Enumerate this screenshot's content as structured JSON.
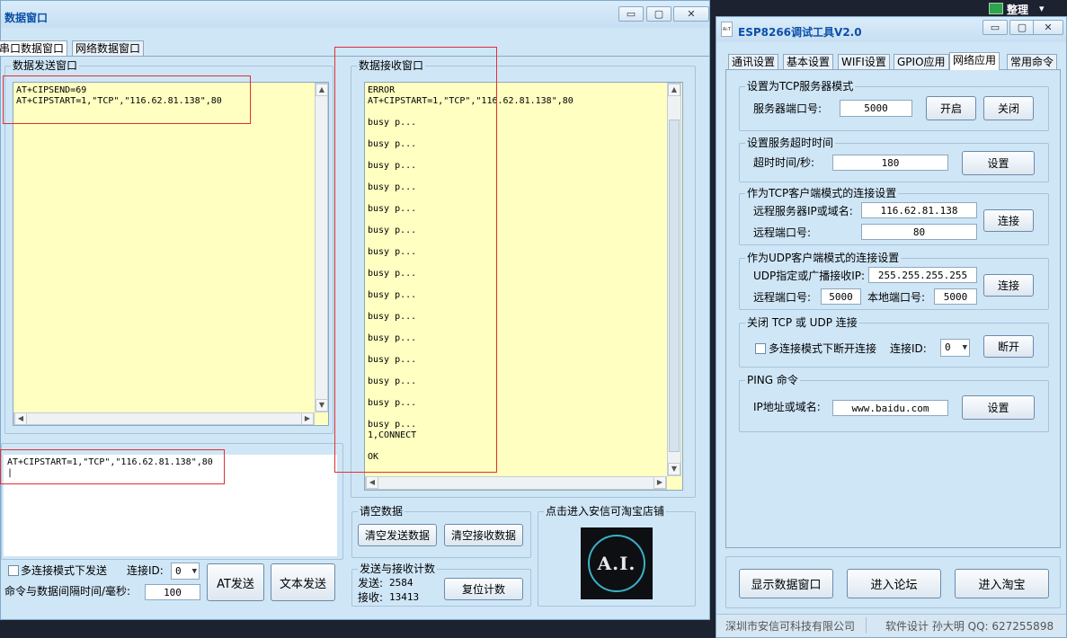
{
  "taskbar": {
    "label": "整理",
    "arrow": "▾"
  },
  "data_window": {
    "title": "数据窗口",
    "caption": {
      "minimize": "▭",
      "maximize": "▢",
      "close": "✕"
    },
    "tabs": [
      "串口数据窗口",
      "网络数据窗口"
    ],
    "send_group": {
      "title": "数据发送窗口",
      "text": "AT+CIPSEND=69\nAT+CIPSTART=1,\"TCP\",\"116.62.81.138\",80"
    },
    "recv_group": {
      "title": "数据接收窗口",
      "text": "ERROR\nAT+CIPSTART=1,\"TCP\",\"116.62.81.138\",80\n\nbusy p...\n\nbusy p...\n\nbusy p...\n\nbusy p...\n\nbusy p...\n\nbusy p...\n\nbusy p...\n\nbusy p...\n\nbusy p...\n\nbusy p...\n\nbusy p...\n\nbusy p...\n\nbusy p...\n\nbusy p...\n\nbusy p...\n1,CONNECT\n\nOK"
    },
    "command_input": {
      "text": "AT+CIPSTART=1,\"TCP\",\"116.62.81.138\",80\n|"
    },
    "multi_send": {
      "label": "多连接模式下发送",
      "checked": false
    },
    "conn_id": {
      "label": "连接ID:",
      "value": "0"
    },
    "interval": {
      "label": "命令与数据间隔时间/毫秒:",
      "value": "100"
    },
    "at_send_button": "AT发送",
    "text_send_button": "文本发送",
    "clear_group": {
      "title": "请空数据",
      "clear_send": "清空发送数据",
      "clear_recv": "清空接收数据"
    },
    "count_group": {
      "title": "发送与接收计数",
      "send_label": "发送:",
      "send_count": "2584",
      "recv_label": "接收:",
      "recv_count": "13413",
      "reset_button": "复位计数"
    },
    "shop_group": {
      "title": "点击进入安信可淘宝店铺",
      "logo_text": "A.I."
    }
  },
  "tool_window": {
    "title": "ESP8266调试工具V2.0",
    "logo_text": "Ai-T",
    "caption": {
      "minimize": "▭",
      "maximize": "▢",
      "close": "✕"
    },
    "tabs": [
      "通讯设置",
      "基本设置",
      "WIFI设置",
      "GPIO应用",
      "网络应用",
      "常用命令"
    ],
    "tcp_server": {
      "title": "设置为TCP服务器模式",
      "port_label": "服务器端口号:",
      "port": "5000",
      "open": "开启",
      "close": "关闭"
    },
    "timeout": {
      "title": "设置服务超时时间",
      "label": "超时时间/秒:",
      "value": "180",
      "button": "设置"
    },
    "tcp_client": {
      "title": "作为TCP客户端模式的连接设置",
      "ip_label": "远程服务器IP或域名:",
      "ip": "116.62.81.138",
      "port_label": "远程端口号:",
      "port": "80",
      "button": "连接"
    },
    "udp_client": {
      "title": "作为UDP客户端模式的连接设置",
      "ip_label": "UDP指定或广播接收IP:",
      "ip": "255.255.255.255",
      "rport_label": "远程端口号:",
      "rport": "5000",
      "lport_label": "本地端口号:",
      "lport": "5000",
      "button": "连接"
    },
    "close_conn": {
      "title": "关闭 TCP 或 UDP 连接",
      "multi_label": "多连接模式下断开连接",
      "id_label": "连接ID:",
      "id_value": "0",
      "button": "断开"
    },
    "ping": {
      "title": "PING 命令",
      "label": "IP地址或域名:",
      "value": "www.baidu.com",
      "button": "设置"
    },
    "bottom_buttons": [
      "显示数据窗口",
      "进入论坛",
      "进入淘宝"
    ],
    "status": {
      "company": "深圳市安信可科技有限公司",
      "author": "软件设计 孙大明 QQ: 627255898"
    }
  }
}
